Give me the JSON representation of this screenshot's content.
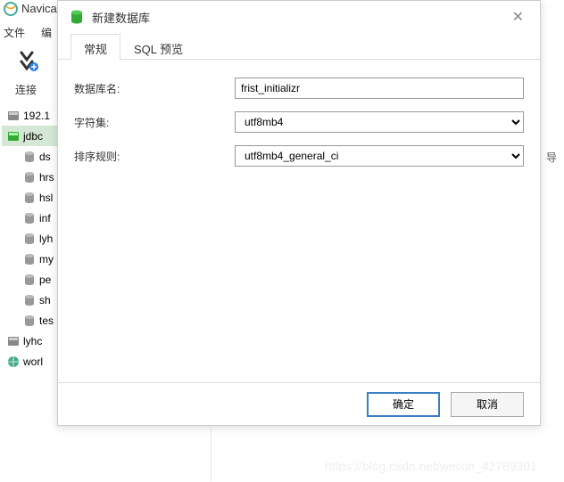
{
  "app": {
    "title": "Navica"
  },
  "menu": {
    "file": "文件",
    "edit": "编"
  },
  "toolbar": {
    "connect": "连接"
  },
  "tree": {
    "items": [
      {
        "label": "192.1",
        "type": "server",
        "selected": false
      },
      {
        "label": "jdbc",
        "type": "server-green",
        "selected": true
      },
      {
        "label": "ds",
        "type": "db"
      },
      {
        "label": "hrs",
        "type": "db"
      },
      {
        "label": "hsl",
        "type": "db"
      },
      {
        "label": "inf",
        "type": "db"
      },
      {
        "label": "lyh",
        "type": "db"
      },
      {
        "label": "my",
        "type": "db"
      },
      {
        "label": "pe",
        "type": "db"
      },
      {
        "label": "sh",
        "type": "db"
      },
      {
        "label": "tes",
        "type": "db"
      },
      {
        "label": "lyhc",
        "type": "server"
      },
      {
        "label": "worl",
        "type": "server-globe"
      }
    ]
  },
  "dialog": {
    "title": "新建数据库",
    "tabs": {
      "general": "常规",
      "sql": "SQL 预览"
    },
    "fields": {
      "dbname_label": "数据库名:",
      "dbname_value": "frist_initializr",
      "charset_label": "字符集:",
      "charset_value": "utf8mb4",
      "collation_label": "排序规则:",
      "collation_value": "utf8mb4_general_ci"
    },
    "buttons": {
      "ok": "确定",
      "cancel": "取消"
    }
  },
  "right_label": "导",
  "watermark": "https://blog.csdn.net/weixin_42789301"
}
